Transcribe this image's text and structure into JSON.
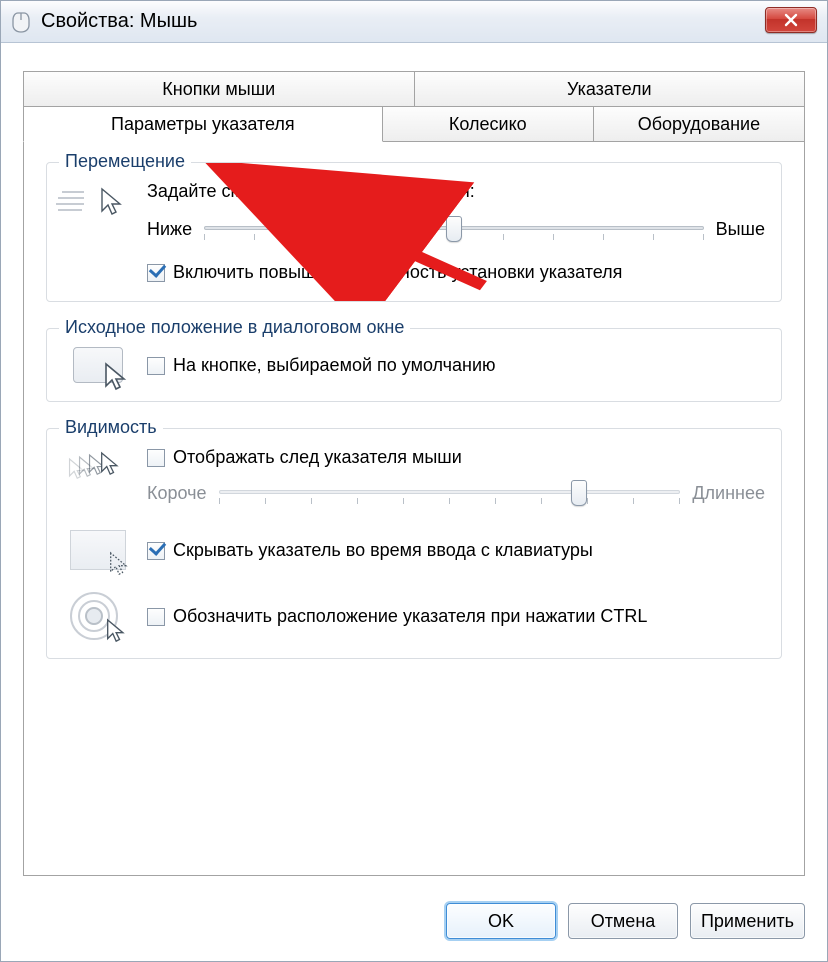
{
  "window": {
    "title": "Свойства: Мышь"
  },
  "tabs": {
    "row1": [
      {
        "label": "Кнопки мыши",
        "active": false
      },
      {
        "label": "Указатели",
        "active": false
      }
    ],
    "row2": [
      {
        "label": "Параметры указателя",
        "active": true
      },
      {
        "label": "Колесико",
        "active": false
      },
      {
        "label": "Оборудование",
        "active": false
      }
    ]
  },
  "motion": {
    "legend": "Перемещение",
    "heading": "Задайте скорость движения указателя:",
    "slow": "Ниже",
    "fast": "Выше",
    "slider_value": 6,
    "slider_max": 11,
    "enhance_checked": true,
    "enhance_label": "Включить повышенную точность установки указателя"
  },
  "snap": {
    "legend": "Исходное положение в диалоговом окне",
    "checked": false,
    "label": "На кнопке, выбираемой по умолчанию"
  },
  "visibility": {
    "legend": "Видимость",
    "trail_checked": false,
    "trail_label": "Отображать след указателя мыши",
    "trail_short": "Короче",
    "trail_long": "Длиннее",
    "trail_value": 8,
    "trail_max": 11,
    "hide_checked": true,
    "hide_label": "Скрывать указатель во время ввода с клавиатуры",
    "locate_checked": false,
    "locate_label": "Обозначить расположение указателя при нажатии CTRL"
  },
  "buttons": {
    "ok": "OK",
    "cancel": "Отмена",
    "apply": "Применить"
  }
}
